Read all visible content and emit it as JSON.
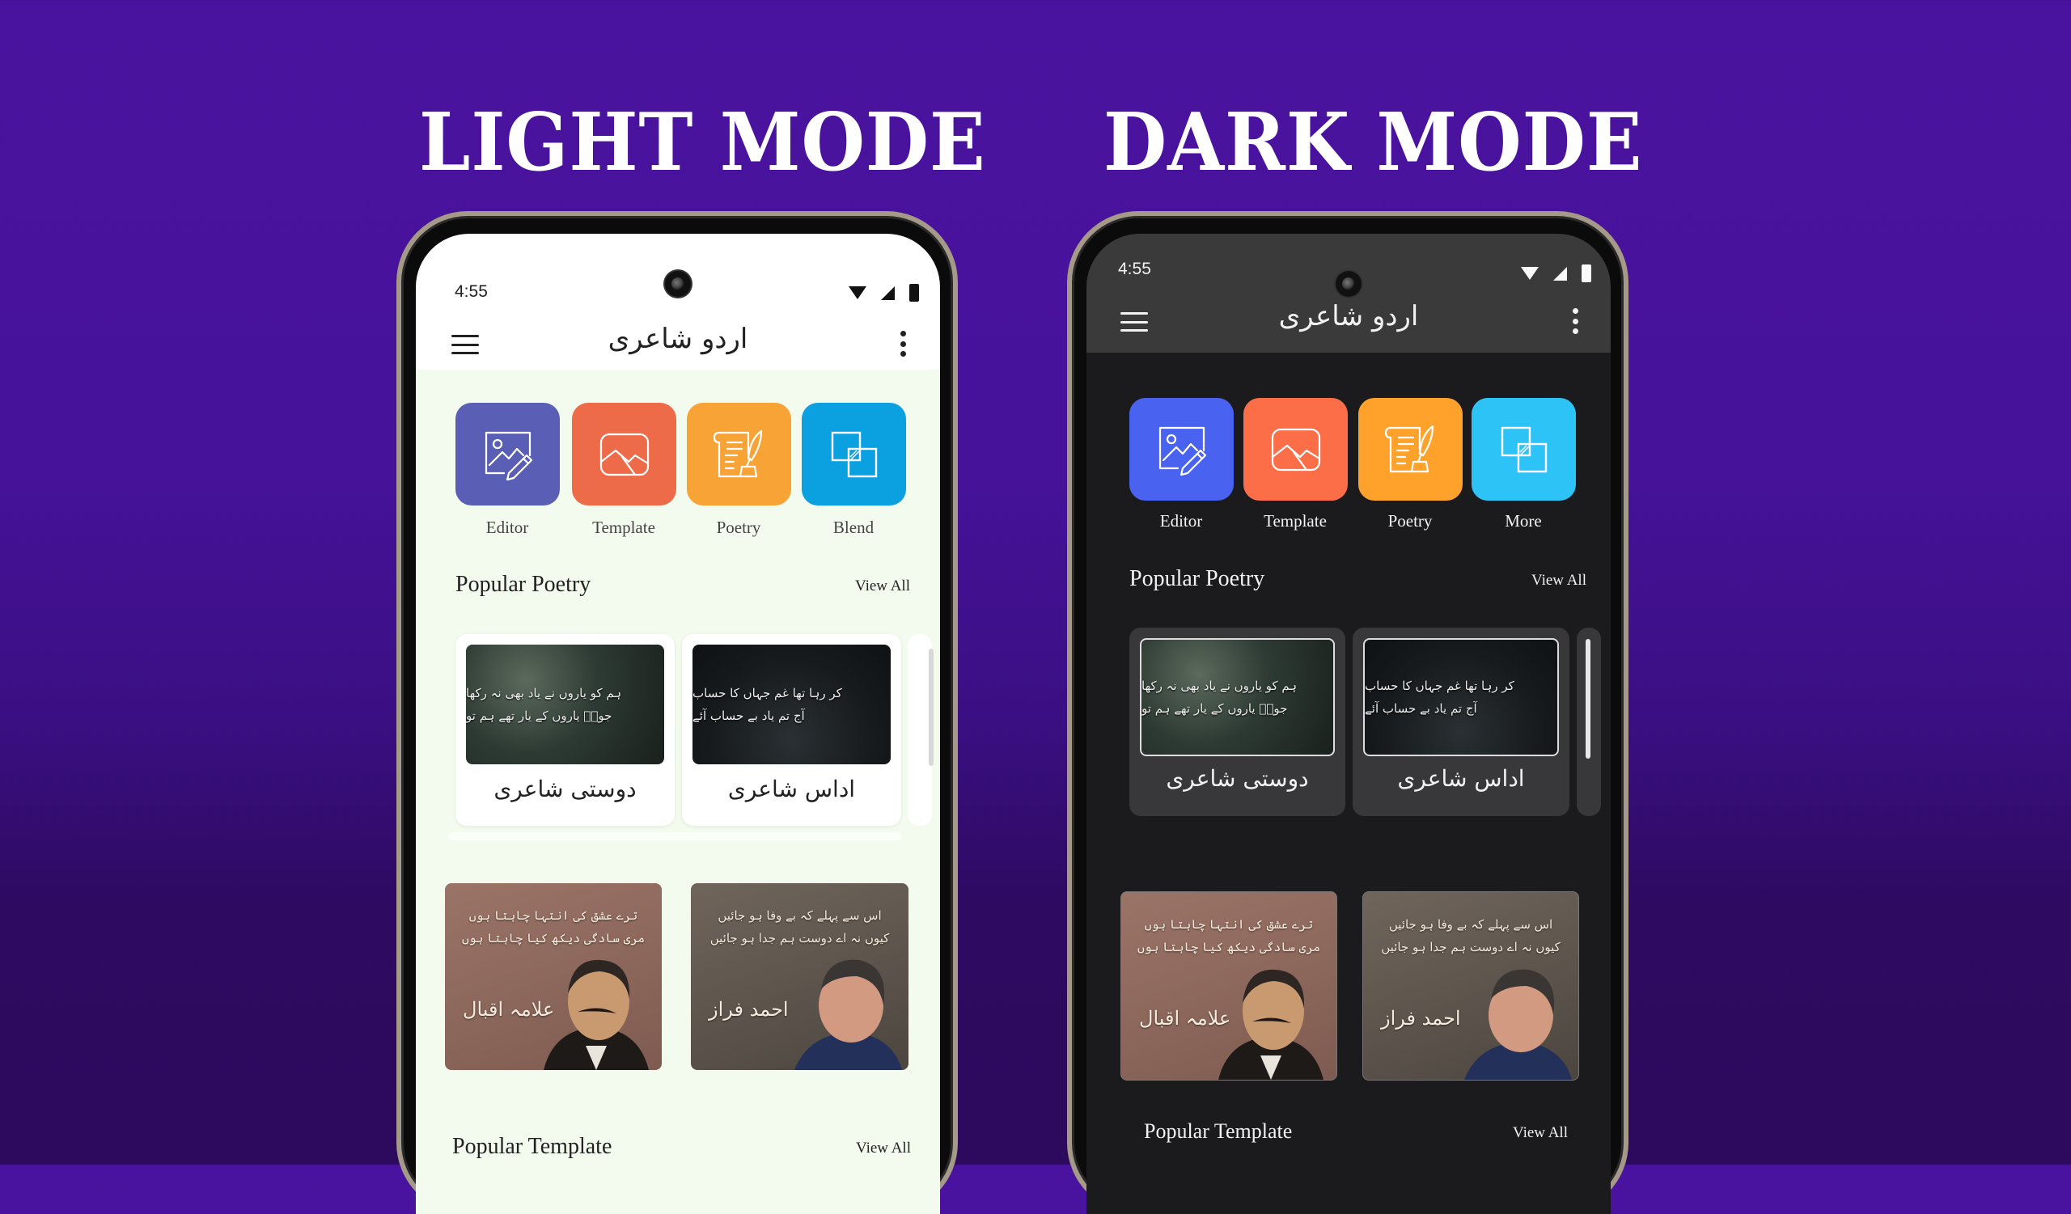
{
  "background": {
    "top_color": "#4a139f",
    "bottom_color": "#2d0a5e"
  },
  "headings": {
    "light": "LIGHT MODE",
    "dark": "DARK MODE"
  },
  "phones": {
    "light": {
      "status_time": "4:55",
      "app_title": "اردو شاعری",
      "colors": {
        "screen_bg": "#ffffff",
        "content_bg": "#f3fbef",
        "text": "#222222",
        "card_bg": "#ffffff"
      },
      "tiles": [
        {
          "label": "Editor",
          "icon": "image-edit-icon",
          "color": "#5a5fb5"
        },
        {
          "label": "Template",
          "icon": "landscape-frame-icon",
          "color": "#ee6b4a"
        },
        {
          "label": "Poetry",
          "icon": "scroll-quill-icon",
          "color": "#f7a336"
        },
        {
          "label": "Blend",
          "icon": "overlap-squares-icon",
          "color": "#0ba0e0"
        }
      ],
      "popular_poetry": {
        "title": "Popular Poetry",
        "view_all": "View All",
        "cards": [
          {
            "caption": "دوستی شاعری",
            "verse": [
              "ہم کو یاروں نے یاد بھی نہ رکھا",
              "جونؔ یاروں کے یار تھے ہم تو"
            ]
          },
          {
            "caption": "اداس شاعری",
            "verse": [
              "کر رہا تھا غم جہاں کا حساب",
              "آج تم یاد بے حساب آئے"
            ]
          }
        ]
      },
      "templates": [
        {
          "poet": "علامہ اقبال",
          "verse": [
            "ترے عشق کی انتہا چاہتا ہوں",
            "مری سادگی دیکھ کیا چاہتا ہوں"
          ]
        },
        {
          "poet": "احمد فراز",
          "verse": [
            "اس سے پہلے کہ بے وفا ہو جائیں",
            "کیوں نہ اے دوست ہم جدا ہو جائیں"
          ]
        }
      ],
      "popular_template": {
        "title": "Popular Template",
        "view_all": "View All"
      }
    },
    "dark": {
      "status_time": "4:55",
      "app_title": "اردو شاعری",
      "colors": {
        "header_bg": "#3a3a3b",
        "content_bg": "#1b1b1e",
        "text": "#f2f2f2",
        "card_bg": "#38383b"
      },
      "tiles": [
        {
          "label": "Editor",
          "icon": "image-edit-icon",
          "color": "#4a62f0"
        },
        {
          "label": "Template",
          "icon": "landscape-frame-icon",
          "color": "#fb6e48"
        },
        {
          "label": "Poetry",
          "icon": "scroll-quill-icon",
          "color": "#ffa22b"
        },
        {
          "label": "More",
          "icon": "overlap-squares-icon",
          "color": "#2ec3f6"
        }
      ],
      "popular_poetry": {
        "title": "Popular Poetry",
        "view_all": "View All",
        "cards": [
          {
            "caption": "دوستی شاعری",
            "verse": [
              "ہم کو یاروں نے یاد بھی نہ رکھا",
              "جونؔ یاروں کے یار تھے ہم تو"
            ]
          },
          {
            "caption": "اداس شاعری",
            "verse": [
              "کر رہا تھا غم جہاں کا حساب",
              "آج تم یاد بے حساب آئے"
            ]
          }
        ]
      },
      "templates": [
        {
          "poet": "علامہ اقبال",
          "verse": [
            "ترے عشق کی انتہا چاہتا ہوں",
            "مری سادگی دیکھ کیا چاہتا ہوں"
          ]
        },
        {
          "poet": "احمد فراز",
          "verse": [
            "اس سے پہلے کہ بے وفا ہو جائیں",
            "کیوں نہ اے دوست ہم جدا ہو جائیں"
          ]
        }
      ],
      "popular_template": {
        "title": "Popular Template",
        "view_all": "View All"
      }
    }
  }
}
